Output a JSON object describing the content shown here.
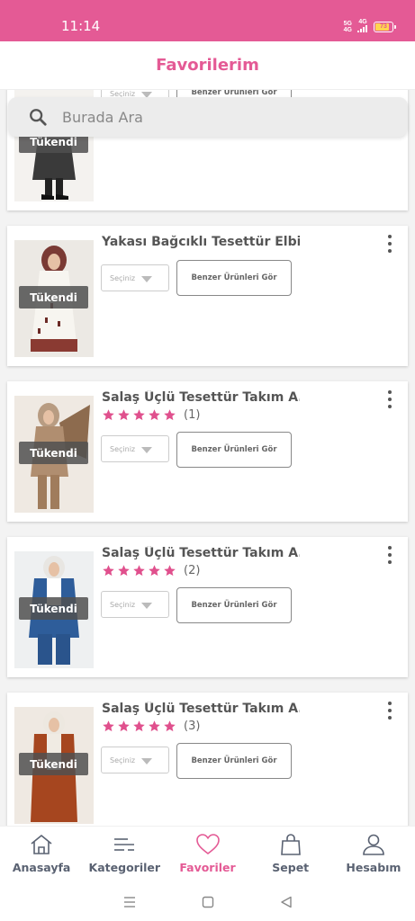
{
  "status_bar": {
    "time": "11:14",
    "sim_label_top": "5G",
    "sim_label_bottom": "4G",
    "network_label": "4G",
    "battery": "73",
    "battery_level": 0.73
  },
  "header": {
    "title": "Favorilerim"
  },
  "search": {
    "placeholder": "Burada Ara"
  },
  "products": [
    {
      "name": "",
      "status": "Tükendi",
      "select_label": "Seçiniz",
      "similar_label": "Benzer Ürünleri Gör",
      "rating": null,
      "review_count": ""
    },
    {
      "name": "Yakası Bağcıklı Tesettür Elbi...",
      "status": "Tükendi",
      "select_label": "Seçiniz",
      "similar_label": "Benzer Ürünleri Gör",
      "rating": null,
      "review_count": ""
    },
    {
      "name": "Salaş Üçlü Tesettür Takım A...",
      "status": "Tükendi",
      "select_label": "Seçiniz",
      "similar_label": "Benzer Ürünleri Gör",
      "rating": 5,
      "review_count": "(1)"
    },
    {
      "name": "Salaş Üçlü Tesettür Takım A...",
      "status": "Tükendi",
      "select_label": "Seçiniz",
      "similar_label": "Benzer Ürünleri Gör",
      "rating": 5,
      "review_count": "(2)"
    },
    {
      "name": "Salaş Üçlü Tesettür Takım A...",
      "status": "Tükendi",
      "select_label": "Seçiniz",
      "similar_label": "Benzer Ürünleri Gör",
      "rating": 5,
      "review_count": "(3)"
    }
  ],
  "bottom_nav": {
    "items": [
      {
        "label": "Anasayfa",
        "icon": "home-icon"
      },
      {
        "label": "Kategoriler",
        "icon": "categories-icon"
      },
      {
        "label": "Favoriler",
        "icon": "heart-icon"
      },
      {
        "label": "Sepet",
        "icon": "bag-icon"
      },
      {
        "label": "Hesabım",
        "icon": "user-icon"
      }
    ],
    "active_index": 2
  },
  "colors": {
    "brand": "#e45a95",
    "star": "#e0508d",
    "nav_text": "#5a6272"
  },
  "system_nav": {
    "buttons": [
      "menu-icon",
      "home-square-icon",
      "back-triangle-icon"
    ]
  }
}
